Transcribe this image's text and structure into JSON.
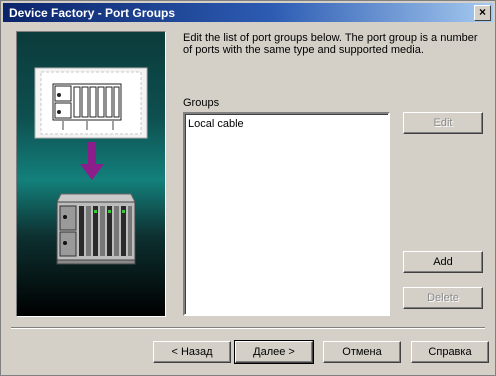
{
  "window": {
    "title": "Device Factory - Port Groups",
    "close_glyph": "×"
  },
  "description": "Edit the list of port groups below. The port group is a number of ports with the same type and supported media.",
  "groups": {
    "label": "Groups",
    "items": [
      "Local cable"
    ]
  },
  "side_buttons": {
    "edit": "Edit",
    "add": "Add",
    "delete": "Delete"
  },
  "footer_buttons": {
    "back": "< Назад",
    "next": "Далее >",
    "cancel": "Отмена",
    "help": "Справка"
  },
  "illustration": {
    "arrow_color": "#8b1e8b",
    "background_top": "#0e4f4f"
  }
}
